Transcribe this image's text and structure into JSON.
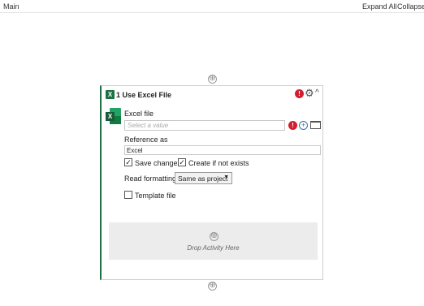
{
  "topbar": {
    "breadcrumb": "Main",
    "expand_all": "Expand All",
    "collapse_all": "Collapse ."
  },
  "add_symbol": "⊕",
  "activity": {
    "icon_letter": "X",
    "title": "1  Use Excel File",
    "error_symbol": "!",
    "gear_symbol": "⚙",
    "collapse_symbol": "^",
    "excel_file_label": "Excel file",
    "excel_file_placeholder": "Select a value",
    "plus_symbol": "+",
    "reference_as_label": "Reference as",
    "reference_as_value": "Excel",
    "save_changes": {
      "label": "Save changes",
      "checked": true
    },
    "create_if_not_exists": {
      "label": "Create if not exists",
      "checked": true
    },
    "read_formatting_label": "Read formatting",
    "read_formatting_value": "Same as project",
    "template_file": {
      "label": "Template file",
      "checked": false
    },
    "drop_text": "Drop Activity Here",
    "check_mark": "✓",
    "dropdown_arrow": "▼"
  },
  "colors": {
    "excel_green": "#1e7145",
    "error_red": "#d21f2f",
    "drop_zone": "#ececec"
  },
  "icons": [
    "excel-icon",
    "error-icon",
    "gear-icon",
    "chevron-up-icon",
    "plus-circle-icon",
    "folder-icon",
    "add-activity-icon"
  ]
}
